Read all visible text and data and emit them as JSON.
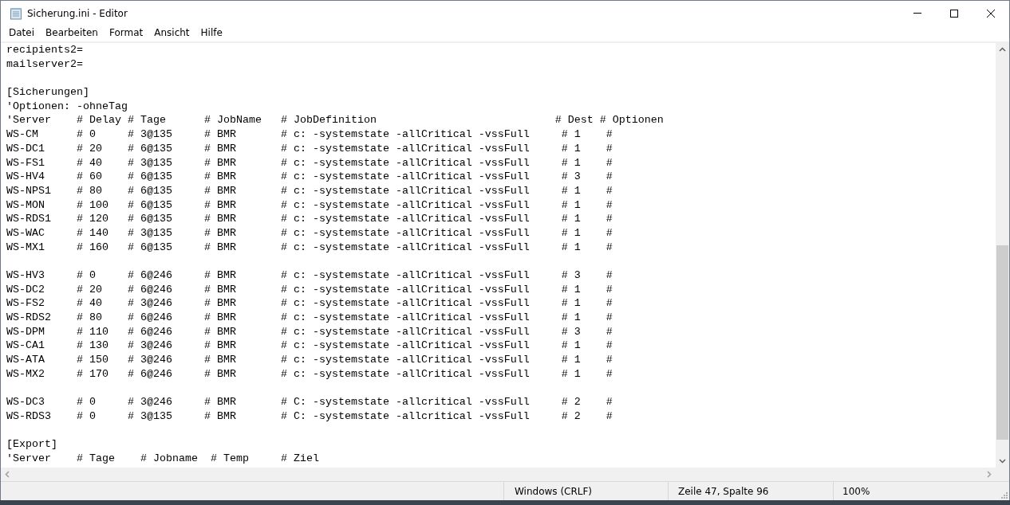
{
  "window": {
    "title": "Sicherung.ini - Editor"
  },
  "menu": [
    "Datei",
    "Bearbeiten",
    "Format",
    "Ansicht",
    "Hilfe"
  ],
  "editor": {
    "blocks": [
      [
        "recipients2=",
        "mailserver2="
      ],
      [
        "[Sicherungen]",
        "'Optionen: -ohneTag",
        "'Server    # Delay # Tage      # JobName   # JobDefinition                            # Dest # Optionen",
        "WS-CM      # 0     # 3@135     # BMR       # c: -systemstate -allCritical -vssFull     # 1    #",
        "WS-DC1     # 20    # 6@135     # BMR       # c: -systemstate -allCritical -vssFull     # 1    #",
        "WS-FS1     # 40    # 3@135     # BMR       # c: -systemstate -allCritical -vssFull     # 1    #",
        "WS-HV4     # 60    # 6@135     # BMR       # c: -systemstate -allCritical -vssFull     # 3    #",
        "WS-NPS1    # 80    # 6@135     # BMR       # c: -systemstate -allCritical -vssFull     # 1    #",
        "WS-MON     # 100   # 6@135     # BMR       # c: -systemstate -allCritical -vssFull     # 1    #",
        "WS-RDS1    # 120   # 6@135     # BMR       # c: -systemstate -allCritical -vssFull     # 1    #",
        "WS-WAC     # 140   # 3@135     # BMR       # c: -systemstate -allCritical -vssFull     # 1    #",
        "WS-MX1     # 160   # 6@135     # BMR       # c: -systemstate -allCritical -vssFull     # 1    #"
      ],
      [
        "WS-HV3     # 0     # 6@246     # BMR       # c: -systemstate -allCritical -vssFull     # 3    #",
        "WS-DC2     # 20    # 6@246     # BMR       # c: -systemstate -allCritical -vssFull     # 1    #",
        "WS-FS2     # 40    # 3@246     # BMR       # c: -systemstate -allCritical -vssFull     # 1    #",
        "WS-RDS2    # 80    # 6@246     # BMR       # c: -systemstate -allCritical -vssFull     # 1    #",
        "WS-DPM     # 110   # 6@246     # BMR       # c: -systemstate -allCritical -vssFull     # 3    #",
        "WS-CA1     # 130   # 3@246     # BMR       # c: -systemstate -allCritical -vssFull     # 1    #",
        "WS-ATA     # 150   # 3@246     # BMR       # c: -systemstate -allCritical -vssFull     # 1    #",
        "WS-MX2     # 170   # 6@246     # BMR       # c: -systemstate -allCritical -vssFull     # 1    #"
      ],
      [
        "WS-DC3     # 0     # 3@246     # BMR       # C: -systemstate -allcritical -vssFull     # 2    #",
        "WS-RDS3    # 0     # 3@135     # BMR       # C: -systemstate -allcritical -vssFull     # 2    #"
      ],
      [
        "[Export]",
        "'Server    # Tage    # Jobname  # Temp     # Ziel"
      ]
    ]
  },
  "status_bar": [
    "Windows (CRLF)",
    "Zeile 47, Spalte 96",
    "100%"
  ]
}
